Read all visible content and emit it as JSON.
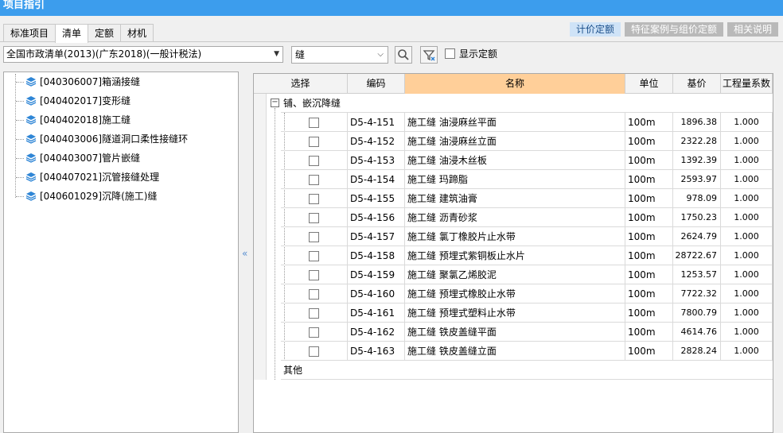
{
  "window": {
    "title": "项目指引"
  },
  "tabs": [
    {
      "label": "标准项目",
      "active": false
    },
    {
      "label": "清单",
      "active": true
    },
    {
      "label": "定额",
      "active": false
    },
    {
      "label": "材机",
      "active": false
    }
  ],
  "top_buttons": [
    {
      "label": "计价定额",
      "active": true
    },
    {
      "label": "特征案例与组价定额",
      "active": false
    },
    {
      "label": "相关说明",
      "active": false
    }
  ],
  "library_select": {
    "value": "全国市政清单(2013)(广东2018)(一般计税法)"
  },
  "filter_input": {
    "value": "缝"
  },
  "icons": {
    "search": "search-icon",
    "filter": "filter-icon",
    "layer": "layer-stack-icon",
    "collapse": "collapse-left-icon"
  },
  "show_quota": {
    "label": "显示定额",
    "checked": false
  },
  "tree": [
    {
      "label": "[040306007]箱涵接缝"
    },
    {
      "label": "[040402017]变形缝"
    },
    {
      "label": "[040402018]施工缝"
    },
    {
      "label": "[040403006]隧道洞口柔性接缝环"
    },
    {
      "label": "[040403007]管片嵌缝"
    },
    {
      "label": "[040407021]沉管接缝处理"
    },
    {
      "label": "[040601029]沉降(施工)缝"
    }
  ],
  "grid": {
    "columns": {
      "select": "选择",
      "code": "编码",
      "name": "名称",
      "unit": "单位",
      "price": "基价",
      "coef": "工程量系数"
    },
    "group": {
      "label": "铺、嵌沉降缝",
      "expander": "−"
    },
    "rows": [
      {
        "code": "D5-4-151",
        "name": "施工缝 油浸麻丝平面",
        "unit": "100m",
        "price": "1896.38",
        "coef": "1.000"
      },
      {
        "code": "D5-4-152",
        "name": "施工缝 油浸麻丝立面",
        "unit": "100m",
        "price": "2322.28",
        "coef": "1.000"
      },
      {
        "code": "D5-4-153",
        "name": "施工缝 油浸木丝板",
        "unit": "100m",
        "price": "1392.39",
        "coef": "1.000"
      },
      {
        "code": "D5-4-154",
        "name": "施工缝 玛蹄脂",
        "unit": "100m",
        "price": "2593.97",
        "coef": "1.000"
      },
      {
        "code": "D5-4-155",
        "name": "施工缝 建筑油膏",
        "unit": "100m",
        "price": "978.09",
        "coef": "1.000"
      },
      {
        "code": "D5-4-156",
        "name": "施工缝 沥青砂浆",
        "unit": "100m",
        "price": "1750.23",
        "coef": "1.000"
      },
      {
        "code": "D5-4-157",
        "name": "施工缝 氯丁橡胶片止水带",
        "unit": "100m",
        "price": "2624.79",
        "coef": "1.000"
      },
      {
        "code": "D5-4-158",
        "name": "施工缝 预埋式紫铜板止水片",
        "unit": "100m",
        "price": "28722.67",
        "coef": "1.000"
      },
      {
        "code": "D5-4-159",
        "name": "施工缝 聚氯乙烯胶泥",
        "unit": "100m",
        "price": "1253.57",
        "coef": "1.000"
      },
      {
        "code": "D5-4-160",
        "name": "施工缝 预埋式橡胶止水带",
        "unit": "100m",
        "price": "7722.32",
        "coef": "1.000"
      },
      {
        "code": "D5-4-161",
        "name": "施工缝 预埋式塑料止水带",
        "unit": "100m",
        "price": "7800.79",
        "coef": "1.000"
      },
      {
        "code": "D5-4-162",
        "name": "施工缝 铁皮盖缝平面",
        "unit": "100m",
        "price": "4614.76",
        "coef": "1.000"
      },
      {
        "code": "D5-4-163",
        "name": "施工缝 铁皮盖缝立面",
        "unit": "100m",
        "price": "2828.24",
        "coef": "1.000"
      }
    ],
    "footer_group": {
      "label": "其他"
    }
  },
  "colors": {
    "title_bar": "#3c9ded",
    "name_header": "#ffcf99",
    "active_button": "#cfe3f7"
  }
}
